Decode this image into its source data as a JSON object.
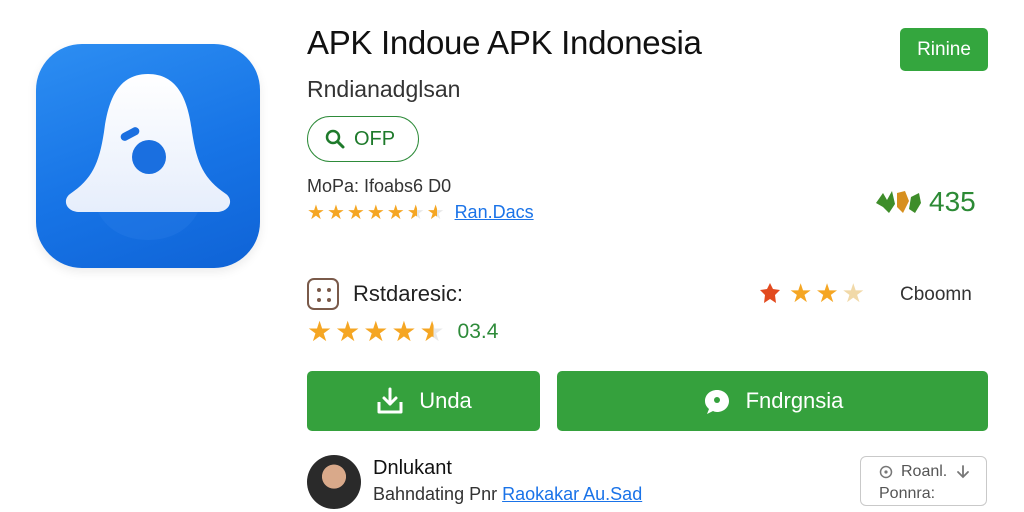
{
  "app": {
    "title": "APK Indoue APK Indonesia",
    "subtitle": "Rndianadglsan",
    "install_label": "Rinine",
    "chip_label": "OFP",
    "meta_line": "MoPa: Ifoabs6 D0",
    "meta_link": "Ran.Dacs",
    "overall_rating": "435",
    "colors": {
      "accent": "#34a63e",
      "brand_icon": "#1774e6",
      "link": "#1a73e8",
      "star": "#f5a623"
    }
  },
  "review_row": {
    "label": "Rstdaresic:",
    "right_label": "Cboomn"
  },
  "stars_value": "03.4",
  "buttons": {
    "primary_label": "Unda",
    "secondary_label": "Fndrgnsia"
  },
  "developer": {
    "name": "Dnlukant",
    "line_prefix": "Bahndating Pnr",
    "line_link": "Raokakar Au.Sad"
  },
  "report": {
    "line1": "Roanl.",
    "line2": "Ponnra:"
  },
  "icons": {
    "app_icon": "bell-app-icon",
    "chip_icon": "search-icon",
    "download_icon": "download-icon",
    "chat_icon": "chat-bubble-icon",
    "dice_icon": "dice-icon",
    "info_icon": "info-icon",
    "arrow_icon": "arrow-down-icon"
  }
}
